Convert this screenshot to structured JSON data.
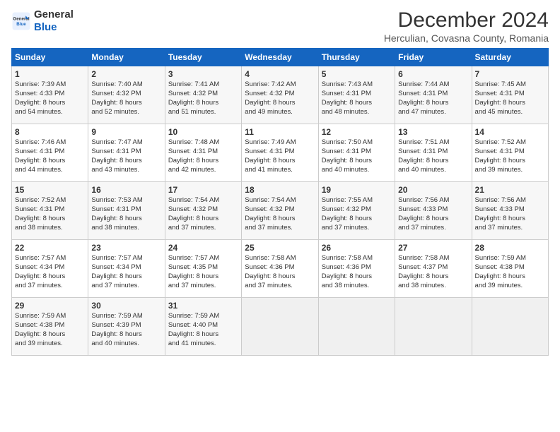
{
  "logo": {
    "line1": "General",
    "line2": "Blue"
  },
  "title": "December 2024",
  "subtitle": "Herculian, Covasna County, Romania",
  "days_of_week": [
    "Sunday",
    "Monday",
    "Tuesday",
    "Wednesday",
    "Thursday",
    "Friday",
    "Saturday"
  ],
  "weeks": [
    [
      {
        "day": 1,
        "rise": "7:39 AM",
        "set": "4:33 PM",
        "daylight": "8 hours and 54 minutes."
      },
      {
        "day": 2,
        "rise": "7:40 AM",
        "set": "4:32 PM",
        "daylight": "8 hours and 52 minutes."
      },
      {
        "day": 3,
        "rise": "7:41 AM",
        "set": "4:32 PM",
        "daylight": "8 hours and 51 minutes."
      },
      {
        "day": 4,
        "rise": "7:42 AM",
        "set": "4:32 PM",
        "daylight": "8 hours and 49 minutes."
      },
      {
        "day": 5,
        "rise": "7:43 AM",
        "set": "4:31 PM",
        "daylight": "8 hours and 48 minutes."
      },
      {
        "day": 6,
        "rise": "7:44 AM",
        "set": "4:31 PM",
        "daylight": "8 hours and 47 minutes."
      },
      {
        "day": 7,
        "rise": "7:45 AM",
        "set": "4:31 PM",
        "daylight": "8 hours and 45 minutes."
      }
    ],
    [
      {
        "day": 8,
        "rise": "7:46 AM",
        "set": "4:31 PM",
        "daylight": "8 hours and 44 minutes."
      },
      {
        "day": 9,
        "rise": "7:47 AM",
        "set": "4:31 PM",
        "daylight": "8 hours and 43 minutes."
      },
      {
        "day": 10,
        "rise": "7:48 AM",
        "set": "4:31 PM",
        "daylight": "8 hours and 42 minutes."
      },
      {
        "day": 11,
        "rise": "7:49 AM",
        "set": "4:31 PM",
        "daylight": "8 hours and 41 minutes."
      },
      {
        "day": 12,
        "rise": "7:50 AM",
        "set": "4:31 PM",
        "daylight": "8 hours and 40 minutes."
      },
      {
        "day": 13,
        "rise": "7:51 AM",
        "set": "4:31 PM",
        "daylight": "8 hours and 40 minutes."
      },
      {
        "day": 14,
        "rise": "7:52 AM",
        "set": "4:31 PM",
        "daylight": "8 hours and 39 minutes."
      }
    ],
    [
      {
        "day": 15,
        "rise": "7:52 AM",
        "set": "4:31 PM",
        "daylight": "8 hours and 38 minutes."
      },
      {
        "day": 16,
        "rise": "7:53 AM",
        "set": "4:31 PM",
        "daylight": "8 hours and 38 minutes."
      },
      {
        "day": 17,
        "rise": "7:54 AM",
        "set": "4:32 PM",
        "daylight": "8 hours and 37 minutes."
      },
      {
        "day": 18,
        "rise": "7:54 AM",
        "set": "4:32 PM",
        "daylight": "8 hours and 37 minutes."
      },
      {
        "day": 19,
        "rise": "7:55 AM",
        "set": "4:32 PM",
        "daylight": "8 hours and 37 minutes."
      },
      {
        "day": 20,
        "rise": "7:56 AM",
        "set": "4:33 PM",
        "daylight": "8 hours and 37 minutes."
      },
      {
        "day": 21,
        "rise": "7:56 AM",
        "set": "4:33 PM",
        "daylight": "8 hours and 37 minutes."
      }
    ],
    [
      {
        "day": 22,
        "rise": "7:57 AM",
        "set": "4:34 PM",
        "daylight": "8 hours and 37 minutes."
      },
      {
        "day": 23,
        "rise": "7:57 AM",
        "set": "4:34 PM",
        "daylight": "8 hours and 37 minutes."
      },
      {
        "day": 24,
        "rise": "7:57 AM",
        "set": "4:35 PM",
        "daylight": "8 hours and 37 minutes."
      },
      {
        "day": 25,
        "rise": "7:58 AM",
        "set": "4:36 PM",
        "daylight": "8 hours and 37 minutes."
      },
      {
        "day": 26,
        "rise": "7:58 AM",
        "set": "4:36 PM",
        "daylight": "8 hours and 38 minutes."
      },
      {
        "day": 27,
        "rise": "7:58 AM",
        "set": "4:37 PM",
        "daylight": "8 hours and 38 minutes."
      },
      {
        "day": 28,
        "rise": "7:59 AM",
        "set": "4:38 PM",
        "daylight": "8 hours and 39 minutes."
      }
    ],
    [
      {
        "day": 29,
        "rise": "7:59 AM",
        "set": "4:38 PM",
        "daylight": "8 hours and 39 minutes."
      },
      {
        "day": 30,
        "rise": "7:59 AM",
        "set": "4:39 PM",
        "daylight": "8 hours and 40 minutes."
      },
      {
        "day": 31,
        "rise": "7:59 AM",
        "set": "4:40 PM",
        "daylight": "8 hours and 41 minutes."
      },
      null,
      null,
      null,
      null
    ]
  ],
  "labels": {
    "sunrise": "Sunrise:",
    "sunset": "Sunset:",
    "daylight": "Daylight:"
  }
}
